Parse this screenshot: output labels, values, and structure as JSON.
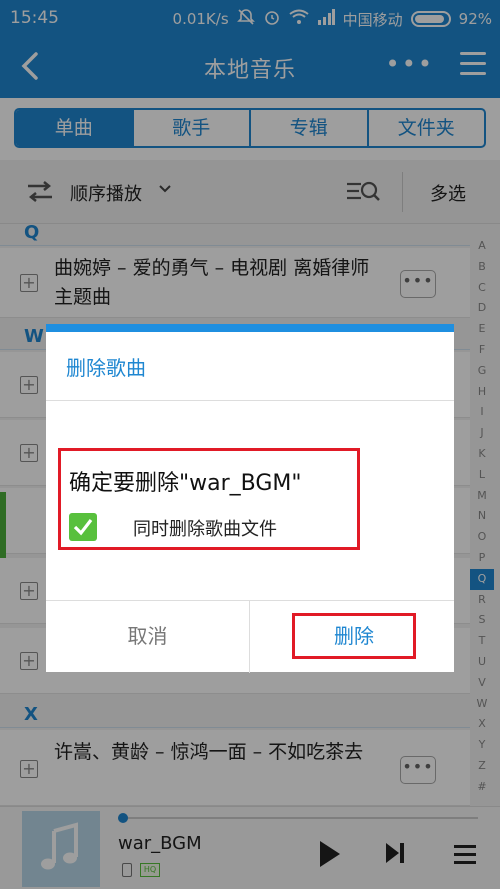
{
  "status_bar": {
    "time": "15:45",
    "net_speed": "0.01K/s",
    "carrier": "中国移动",
    "battery": "92%"
  },
  "app_bar": {
    "title": "本地音乐",
    "more": "•••"
  },
  "tabs": [
    {
      "label": "单曲",
      "active": true
    },
    {
      "label": "歌手",
      "active": false
    },
    {
      "label": "专辑",
      "active": false
    },
    {
      "label": "文件夹",
      "active": false
    }
  ],
  "toolbar": {
    "play_order": "顺序播放",
    "multi_select": "多选"
  },
  "list": {
    "sections": [
      {
        "letter": "Q"
      },
      {
        "letter": "W"
      },
      {
        "letter": "X"
      }
    ],
    "songs": [
      {
        "title": "曲婉婷 – 爱的勇气 – 电视剧 离婚律师 主题曲"
      },
      {
        "title": "许嵩、黄龄 – 惊鸿一面 – 不如吃茶去"
      }
    ],
    "plus": "+",
    "row_more": "•••"
  },
  "alphabet": [
    "A",
    "B",
    "C",
    "D",
    "E",
    "F",
    "G",
    "H",
    "I",
    "J",
    "K",
    "L",
    "M",
    "N",
    "O",
    "P",
    "Q",
    "R",
    "S",
    "T",
    "U",
    "V",
    "W",
    "X",
    "Y",
    "Z",
    "#"
  ],
  "alphabet_active": "Q",
  "dialog": {
    "title": "删除歌曲",
    "confirm_text": "确定要删除\"war_BGM\"",
    "checkbox_label": "同时删除歌曲文件",
    "checkbox_checked": true,
    "cancel": "取消",
    "delete": "删除"
  },
  "player": {
    "title": "war_BGM",
    "quality": "HQ",
    "progress": 0.01
  },
  "colors": {
    "primary": "#1f87d1",
    "highlight_red": "#e11a26",
    "check_green": "#58c03d"
  }
}
